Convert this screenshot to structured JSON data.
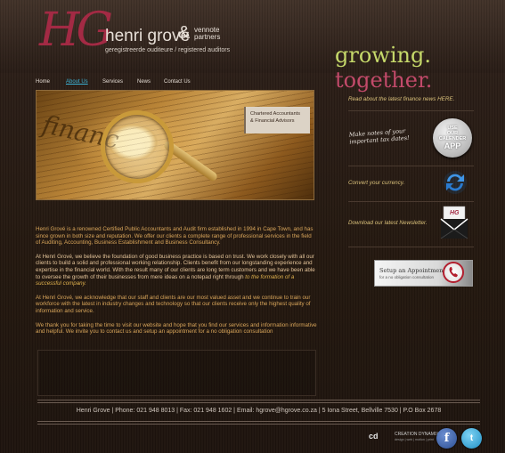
{
  "brand": {
    "monogram": "HG",
    "name": "henri grové",
    "ampersand": "&",
    "partners_line1": "vennote",
    "partners_line2": "partners",
    "subtitle": "geregistreerde ouditeure / registered auditors",
    "colors": {
      "monogram": "#a32a44",
      "slogan_green": "#c6d96a",
      "slogan_pink": "#c24a6a",
      "nav_active": "#3bb3d6"
    }
  },
  "slogan": {
    "word1": "growing.",
    "word2": "together."
  },
  "nav": {
    "items": [
      {
        "label": "Home",
        "active": false
      },
      {
        "label": "About Us",
        "active": true
      },
      {
        "label": "Services",
        "active": false
      },
      {
        "label": "News",
        "active": false
      },
      {
        "label": "Contact Us",
        "active": false
      }
    ]
  },
  "hero": {
    "caption_line1": "Chartered Accountants",
    "caption_line2": "& Financial Advisors"
  },
  "content": {
    "p1": "Henri Grové is a renowned Certified Public Accountants and Audit firm established in 1994 in Cape Town, and has since grown in both size and reputation. We offer our clients a complete range of professional services in the field of Auditing, Accounting, Business Establishment and Business Consultancy.",
    "p2": "At Henri Grové, we believe the foundation of good business practice is based on trust. We work closely with all our clients to build a solid and professional working relationship. Clients benefit from our longstanding experience and expertise in the financial world. With the result many of our clients are long term customers and we have been able to oversee the growth of their businesses from mere ideas on a notepad right through",
    "p2_emphasis": "to the formation of a successful company.",
    "p3": "At Henri Grové, we acknowledge that our staff and clients are our most valued asset and we continue to train our workforce with the latest in industry changes and technology so that our clients receive only the highest quality of information and service.",
    "p4": "We thank you for taking the time to visit our website and hope that you find our services and information informative and helpful. We invite you to contact us and setup an appointment for a no obligation consultation"
  },
  "sidebar": {
    "news_link": "Read about the latest finance news HERE.",
    "notes_text": "Make notes of your important tax dates!",
    "app_badge": {
      "line1": "USE",
      "line2": "OUR",
      "line3": "CALENDER",
      "line4": "APP"
    },
    "currency_link": "Convert your currency.",
    "newsletter_link": "Download our latest Newsletter.",
    "newsletter_icon_text": "HG",
    "appointment": {
      "title": "Setup an Appointment",
      "subtitle": "for a no obligation consultation"
    }
  },
  "footer": {
    "text": "Henri Grove | Phone: 021 948 8013 | Fax: 021 948 1602 | Email: hgrove@hgrove.co.za | 5 Iona Street, Bellville 7530 | P.O Box 2678",
    "credit_mark": "cd",
    "credit_name": "CREATION DYNAMIX",
    "credit_tag": "design | web | motion | print",
    "facebook_glyph": "f",
    "twitter_glyph": "t"
  }
}
